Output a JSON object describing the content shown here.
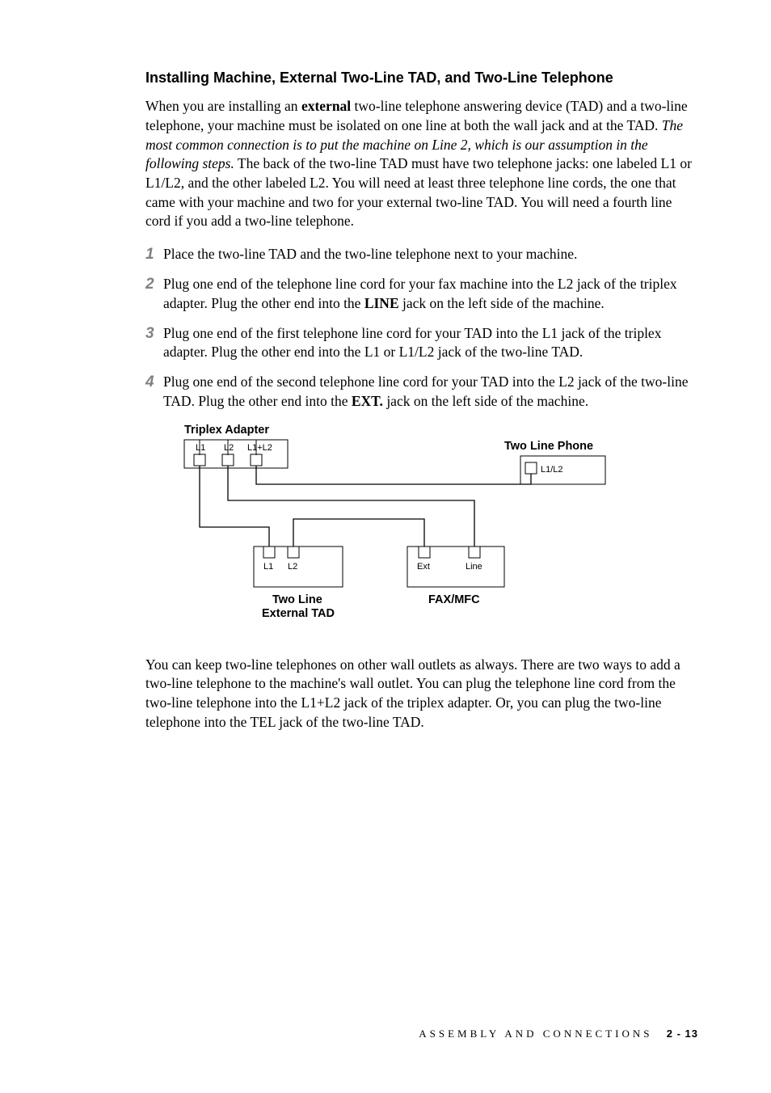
{
  "heading": "Installing Machine, External Two-Line TAD, and Two-Line Telephone",
  "intro": {
    "pre": "When you are installing an ",
    "bold1": "external",
    "mid1": " two-line telephone answering device (TAD) and a two-line telephone, your machine must be isolated on one line at both the wall jack and at the TAD. ",
    "italic": "The most common connection is to put the machine on Line 2, which is our assumption in the following steps.",
    "post": " The back of the two-line TAD must have two telephone jacks: one labeled L1 or L1/L2, and the other labeled L2. You will need at least three telephone line cords, the one that came with your machine and two for your external two-line TAD. You will need a fourth line cord if you add a two-line telephone."
  },
  "steps": [
    {
      "num": "1",
      "pre": "Place the two-line TAD and the two-line telephone next to your machine.",
      "bold": "",
      "post": ""
    },
    {
      "num": "2",
      "pre": "Plug one end of the telephone line cord for your fax machine into the L2 jack of the triplex adapter. Plug the other end into the ",
      "bold": "LINE",
      "post": " jack on the left side of the machine."
    },
    {
      "num": "3",
      "pre": "Plug one end of the first telephone line cord for your TAD into the L1 jack of the triplex adapter. Plug the other end into the L1 or L1/L2 jack of the two-line TAD.",
      "bold": "",
      "post": ""
    },
    {
      "num": "4",
      "pre": "Plug one end of the second telephone line cord for your TAD into the L2 jack of the two-line TAD. Plug the other end into the ",
      "bold": "EXT.",
      "post": " jack on the left side of the machine."
    }
  ],
  "diagram": {
    "label_triplex": "Triplex Adapter",
    "label_twoline_phone": "Two Line Phone",
    "label_twoline_tad1": "Two Line",
    "label_twoline_tad2": "External TAD",
    "label_faxmfc": "FAX/MFC",
    "jack_l1": "L1",
    "jack_l2": "L2",
    "jack_l1l2": "L1+L2",
    "jack_l1l2_phone": "L1/L2",
    "jack_ext": "Ext",
    "jack_line": "Line"
  },
  "closing": "You can keep two-line telephones on other wall outlets as always. There are two ways to add a two-line telephone to the machine's wall outlet. You can plug the telephone line cord from the two-line telephone into the L1+L2 jack of the triplex adapter. Or, you can plug the two-line telephone into the TEL jack of the two-line TAD.",
  "footer": {
    "section": "ASSEMBLY AND CONNECTIONS",
    "page": "2 - 13"
  }
}
